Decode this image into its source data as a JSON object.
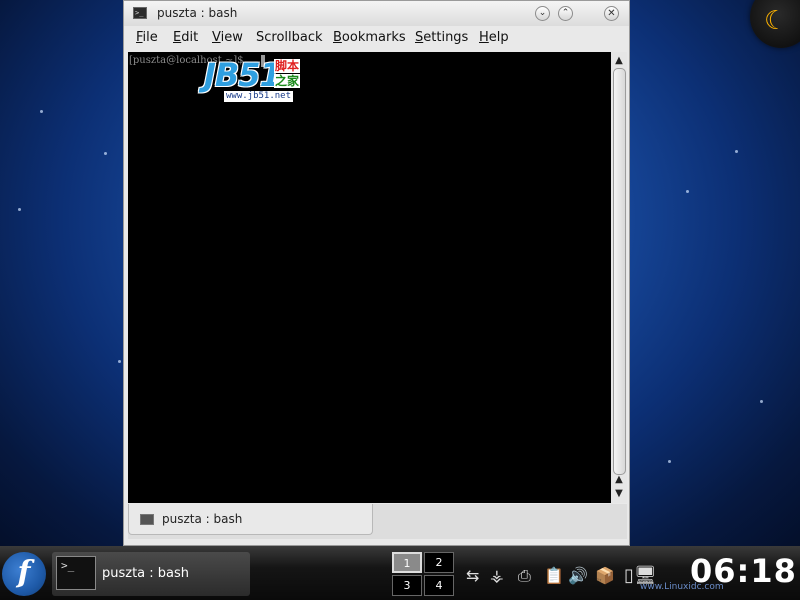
{
  "window": {
    "title": "puszta : bash",
    "buttons": {
      "minimize": "⌄",
      "maximize": "⌃",
      "close": "✕"
    }
  },
  "menu": [
    {
      "label_mnemonic": "F",
      "label_rest": "ile"
    },
    {
      "label_mnemonic": "E",
      "label_rest": "dit"
    },
    {
      "label_mnemonic": "V",
      "label_rest": "iew"
    },
    {
      "label_mnemonic": "",
      "label_rest": "Scrollback"
    },
    {
      "label_mnemonic": "B",
      "label_rest": "ookmarks"
    },
    {
      "label_mnemonic": "S",
      "label_rest": "ettings"
    },
    {
      "label_mnemonic": "H",
      "label_rest": "elp"
    }
  ],
  "terminal": {
    "prompt": "[puszta@localhost ~]$ "
  },
  "watermark": {
    "main": "JB51",
    "cn_line1": "脚本",
    "cn_line2": "之家",
    "url": "www.jb51.net"
  },
  "tab": {
    "label": "puszta : bash"
  },
  "taskbar": {
    "launcher_glyph": "f",
    "task_label": "puszta : bash",
    "task_icon_glyph": ">_",
    "desktops": [
      "1",
      "2",
      "3",
      "4"
    ],
    "active_desktop": "1",
    "clock": "06:18",
    "clock_watermark": "www.Linuxidc.com"
  },
  "icons": {
    "title_icon": "terminal-icon",
    "tab_icon": "terminal-icon",
    "tray": [
      "network-icon",
      "usb-icon",
      "printer-icon",
      "clipboard-icon",
      "volume-icon",
      "package-updater-icon",
      "display-icon"
    ]
  },
  "colors": {
    "terminal_bg": "#000000",
    "desktop_accent": "#1a4fa6",
    "clock": "#ffffff"
  }
}
